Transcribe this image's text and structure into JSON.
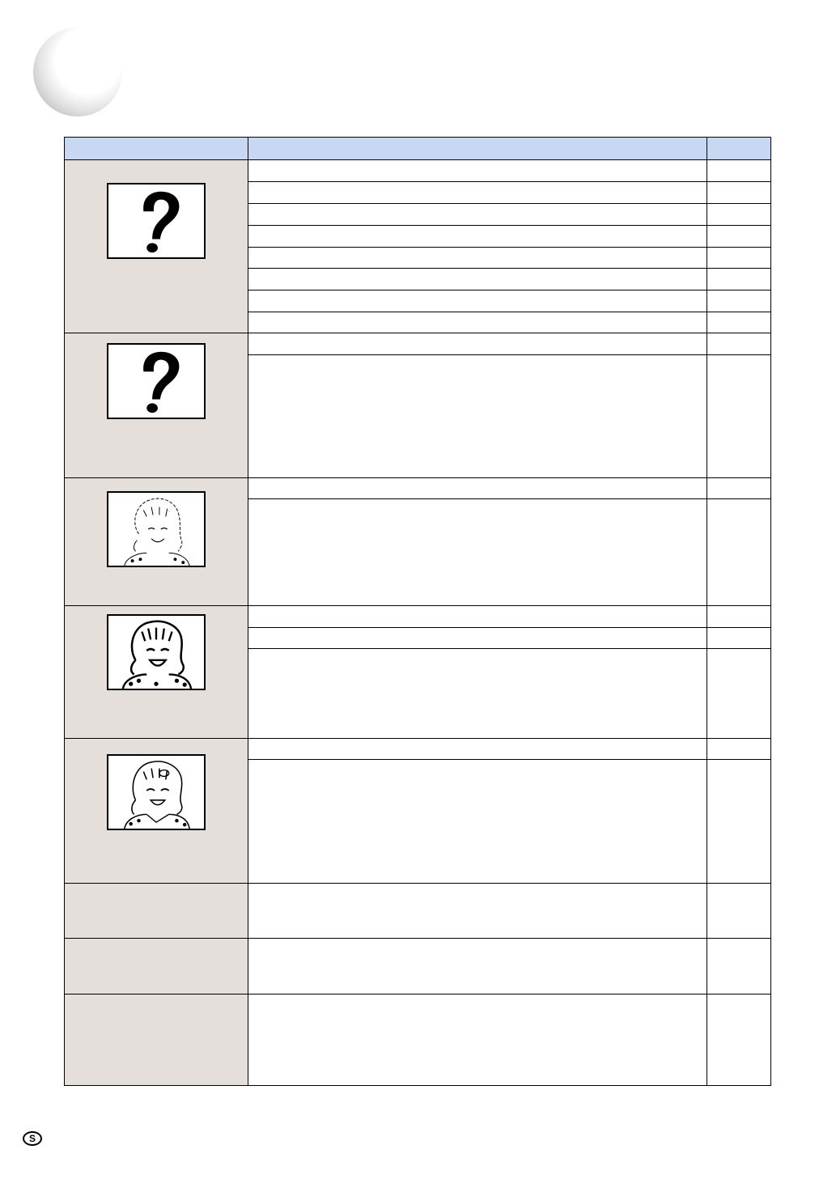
{
  "page": {
    "language_badge": "S"
  },
  "table": {
    "header": [
      "",
      "",
      ""
    ],
    "groups": [
      {
        "figure": "question-mark",
        "rows": 8
      },
      {
        "figure": "question-mark",
        "rows": 2
      },
      {
        "figure": "girl-faint-outline",
        "rows": 2
      },
      {
        "figure": "girl-bold",
        "rows": 3
      },
      {
        "figure": "girl-normal",
        "rows": 2
      },
      {
        "figure": null,
        "rows": 1
      },
      {
        "figure": null,
        "rows": 1
      },
      {
        "figure": null,
        "rows": 1
      }
    ]
  }
}
